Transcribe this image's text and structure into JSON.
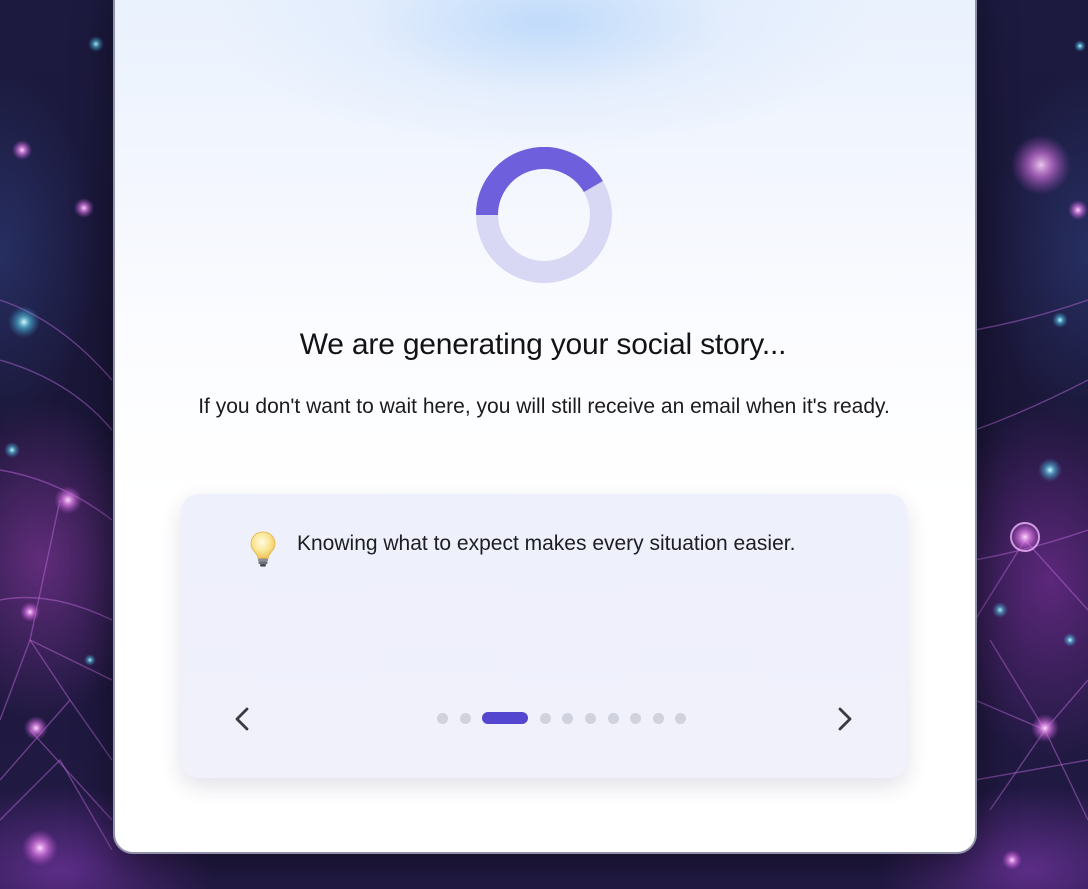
{
  "status": {
    "title": "We are generating your social story...",
    "message": "If you don't want to wait here, you will still receive an email when it's ready."
  },
  "spinner": {
    "icon": "loading-spinner-icon",
    "track_color": "#d9d8f4",
    "arc_color": "#6e60dd"
  },
  "tip": {
    "icon": "lightbulb-icon",
    "text": "Knowing what to expect makes every situation easier."
  },
  "carousel": {
    "prev_icon": "chevron-left-icon",
    "next_icon": "chevron-right-icon",
    "total_pages": 10,
    "current_page": 3,
    "active_color": "#5546cf",
    "inactive_color": "#d0d2dd"
  }
}
